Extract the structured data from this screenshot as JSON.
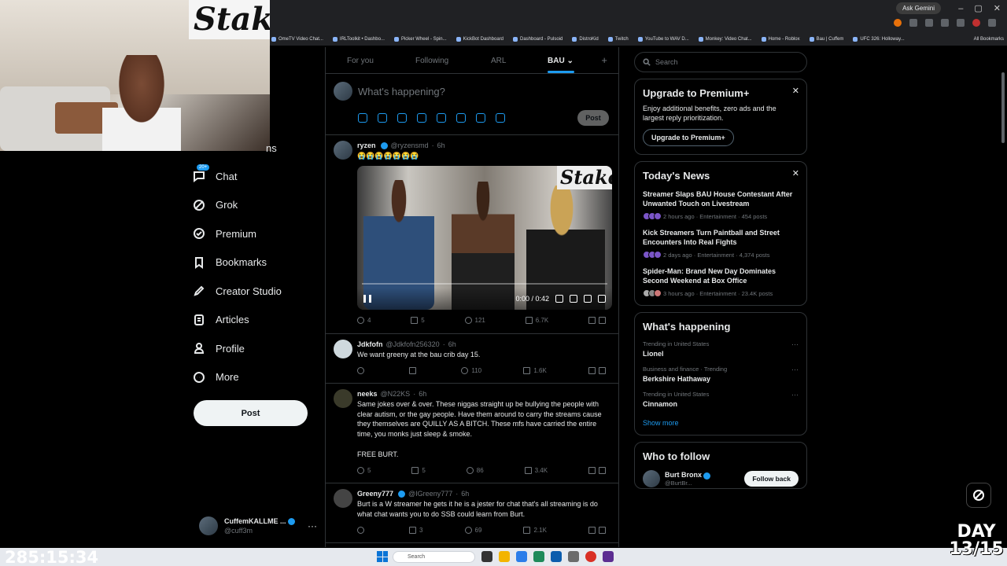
{
  "browser": {
    "ask_gemini": "Ask Gemini",
    "bookmarks": [
      "OmeTV Video Chat...",
      "IRLToolkit • Dashbo...",
      "Picker Wheel - Spin...",
      "KickBot Dashboard",
      "Dashboard - Pulsoid",
      "DistroKid",
      "Twitch",
      "YouTube to WAV D...",
      "Monkey: Video Chat...",
      "Home - Roblox",
      "Bau | Cuffem",
      "UFC 326: Holloway..."
    ],
    "all_bookmarks": "All Bookmarks"
  },
  "webcam": {
    "logo_text": "Stake"
  },
  "leftnav": {
    "hidden_label": "ns",
    "chat_badge": "20+",
    "items": [
      {
        "label": "Chat",
        "icon": "chat-icon"
      },
      {
        "label": "Grok",
        "icon": "grok-icon"
      },
      {
        "label": "Premium",
        "icon": "premium-icon"
      },
      {
        "label": "Bookmarks",
        "icon": "bookmark-icon"
      },
      {
        "label": "Creator Studio",
        "icon": "rocket-icon"
      },
      {
        "label": "Articles",
        "icon": "article-icon"
      },
      {
        "label": "Profile",
        "icon": "person-icon"
      },
      {
        "label": "More",
        "icon": "more-circle-icon"
      }
    ],
    "post_label": "Post",
    "account": {
      "name": "CuffemKALLME ...",
      "handle": "@cuff3m"
    }
  },
  "stream_timer": "285:15:34",
  "feed": {
    "tabs": [
      "For you",
      "Following",
      "ARL",
      "BAU"
    ],
    "active_tab": "BAU",
    "composer_placeholder": "What's happening?",
    "composer_post": "Post",
    "tweets": [
      {
        "name": "ryzen",
        "handle": "@ryzensmd",
        "time": "6h",
        "verified": true,
        "text": "😭😭😭😭😭😭😭",
        "video_time": "0:00 / 0:42",
        "video_logo": "Stake",
        "replies": "4",
        "reposts": "5",
        "likes": "121",
        "views": "6.7K"
      },
      {
        "name": "Jdkfofn",
        "handle": "@Jdkfofn256320",
        "time": "6h",
        "verified": false,
        "text": "We want greeny at the bau crib day 15.",
        "replies": "",
        "reposts": "",
        "likes": "110",
        "views": "1.6K"
      },
      {
        "name": "neeks",
        "handle": "@N22KS",
        "time": "6h",
        "verified": false,
        "text": "Same jokes over & over. These niggas straight up be bullying the people with clear autism, or the gay people. Have them around to carry the streams cause they themselves are QUILLY AS A BITCH. These mfs have carried the entire time, you monks just sleep & smoke.",
        "text2": "FREE BURT.",
        "replies": "5",
        "reposts": "5",
        "likes": "86",
        "views": "3.4K"
      },
      {
        "name": "Greeny777",
        "handle": "@IGreeny777",
        "time": "6h",
        "verified": true,
        "text": "Burt is a W streamer he gets it he is a jester for chat that's all streaming is do what chat wants you to do SSB could learn from Burt.",
        "replies": "",
        "reposts": "3",
        "likes": "69",
        "views": "2.1K"
      }
    ]
  },
  "right": {
    "search_placeholder": "Search",
    "premium": {
      "title": "Upgrade to Premium+",
      "body": "Enjoy additional benefits, zero ads and the largest reply prioritization.",
      "button": "Upgrade to Premium+"
    },
    "news": {
      "title": "Today's News",
      "items": [
        {
          "headline": "Streamer Slaps BAU House Contestant After Unwanted Touch on Livestream",
          "meta": "2 hours ago · Entertainment · 454 posts"
        },
        {
          "headline": "Kick Streamers Turn Paintball and Street Encounters Into Real Fights",
          "meta": "2 days ago · Entertainment · 4,374 posts"
        },
        {
          "headline": "Spider-Man: Brand New Day Dominates Second Weekend at Box Office",
          "meta": "3 hours ago · Entertainment · 23.4K posts"
        }
      ]
    },
    "happening": {
      "title": "What's happening",
      "trends": [
        {
          "context": "Trending in United States",
          "name": "Lionel"
        },
        {
          "context": "Business and finance · Trending",
          "name": "Berkshire Hathaway"
        },
        {
          "context": "Trending in United States",
          "name": "Cinnamon"
        }
      ],
      "show_more": "Show more"
    },
    "who_to_follow": {
      "title": "Who to follow",
      "name": "Burt Bronx",
      "handle": "@BurtBr...",
      "button": "Follow back"
    }
  },
  "overlay": {
    "day_line1": "DAY",
    "day_line2": "13/15"
  },
  "taskbar": {
    "search": "Search"
  },
  "colors": {
    "accent": "#1d9bf0",
    "background": "#000000",
    "border": "#2f3336",
    "muted": "#71767b"
  }
}
